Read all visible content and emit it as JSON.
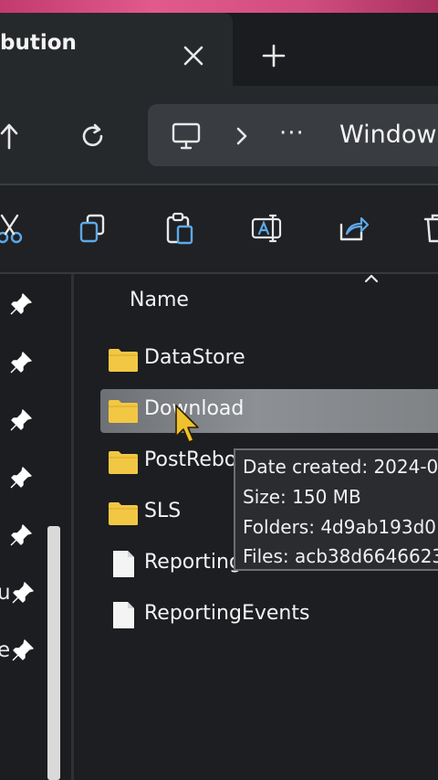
{
  "tab": {
    "title": "bution"
  },
  "address": {
    "more": "···",
    "crumb": "Windows"
  },
  "toolbar": {
    "items": [
      "cut-icon",
      "copy-icon",
      "paste-icon",
      "rename-icon",
      "share-icon",
      "delete-icon"
    ]
  },
  "nav": {
    "partial_labels": [
      "u",
      "e"
    ]
  },
  "content": {
    "column_header": "Name",
    "rows": [
      {
        "name": "DataStore",
        "type": "folder"
      },
      {
        "name": "Download",
        "type": "folder",
        "selected": true
      },
      {
        "name": "PostRebo",
        "type": "folder"
      },
      {
        "name": "SLS",
        "type": "folder"
      },
      {
        "name": "Reporting",
        "type": "file"
      },
      {
        "name": "ReportingEvents",
        "type": "file"
      }
    ]
  },
  "tooltip": {
    "date_created": "Date created: 2024-0",
    "size": "Size: 150 MB",
    "folders": "Folders: 4d9ab193d0",
    "files": "Files: acb38d6646623"
  },
  "colors": {
    "folder": "#f2c744",
    "pin": "#ffffff",
    "accent_tool": "#5ea8e6"
  }
}
